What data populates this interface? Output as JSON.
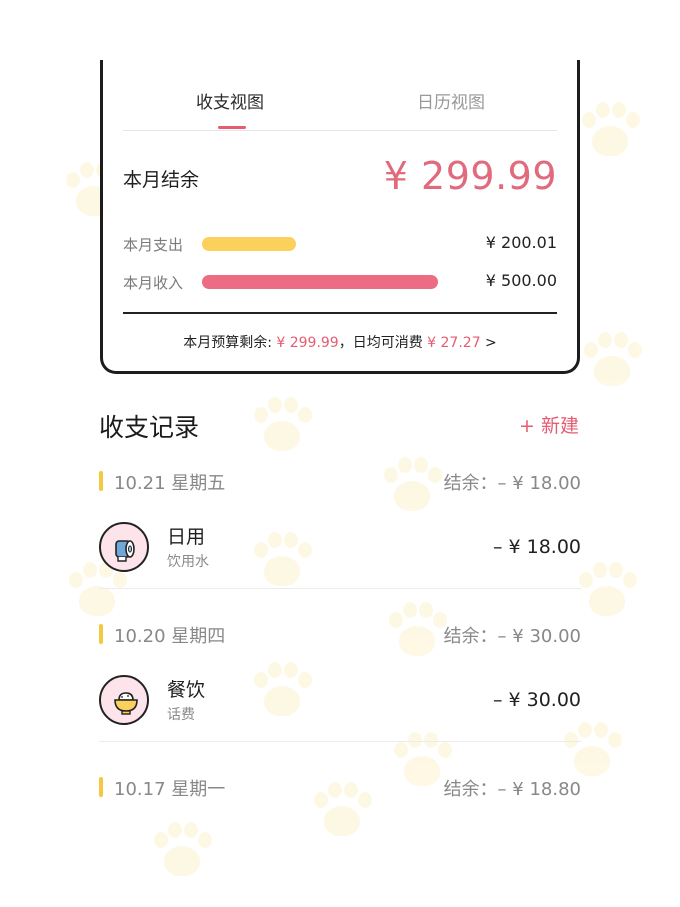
{
  "tabs": {
    "income_expense_view": "收支视图",
    "calendar_view": "日历视图"
  },
  "summary": {
    "balance_label": "本月结余",
    "balance_value": "¥ 299.99",
    "expense_label": "本月支出",
    "expense_value": "¥ 200.01",
    "expense_fraction": 0.4,
    "income_label": "本月收入",
    "income_value": "¥ 500.00",
    "income_fraction": 1.0,
    "budget_prefix": "本月预算剩余: ",
    "budget_value": "¥ 299.99",
    "daily_prefix": "，日均可消费 ",
    "daily_value": "¥ 27.27",
    "chevron": " >"
  },
  "records": {
    "title": "收支记录",
    "new_button": "+ 新建",
    "days": [
      {
        "date": "10.21 星期五",
        "balance": "结余：– ¥ 18.00",
        "entries": [
          {
            "category": "日用",
            "note": "饮用水",
            "amount": "– ¥ 18.00",
            "icon": "toilet-paper-icon"
          }
        ]
      },
      {
        "date": "10.20 星期四",
        "balance": "结余：– ¥ 30.00",
        "entries": [
          {
            "category": "餐饮",
            "note": "话费",
            "amount": "– ¥ 30.00",
            "icon": "rice-bowl-icon"
          }
        ]
      },
      {
        "date": "10.17 星期一",
        "balance": "结余：– ¥ 18.80",
        "entries": []
      }
    ]
  },
  "colors": {
    "accent_pink": "#e45d72",
    "expense_bar": "#fbd15b",
    "income_bar": "#ec6d83",
    "date_marker": "#f5c842",
    "icon_bg": "#fce4ea"
  }
}
